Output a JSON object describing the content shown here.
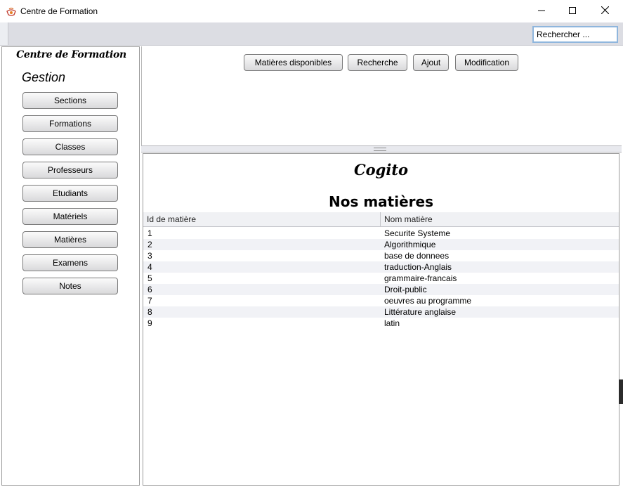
{
  "window": {
    "title": "Centre de Formation",
    "controls": [
      "minimize-icon",
      "maximize-icon",
      "close-icon"
    ]
  },
  "toolbar": {
    "search_value": "Rechercher ..."
  },
  "sidebar": {
    "brand": "Centre de Formation",
    "section_title": "Gestion",
    "items": [
      {
        "label": "Sections"
      },
      {
        "label": "Formations"
      },
      {
        "label": "Classes"
      },
      {
        "label": "Professeurs"
      },
      {
        "label": "Etudiants"
      },
      {
        "label": "Matériels"
      },
      {
        "label": "Matières"
      },
      {
        "label": "Examens"
      },
      {
        "label": "Notes"
      }
    ]
  },
  "actions": {
    "items": [
      {
        "label": "Matières disponibles"
      },
      {
        "label": "Recherche"
      },
      {
        "label": "Ajout"
      },
      {
        "label": "Modification"
      }
    ]
  },
  "main": {
    "brand": "Cogito",
    "title": "Nos matières",
    "columns": [
      "Id de matière",
      "Nom matière"
    ],
    "rows": [
      [
        "1",
        "Securite Systeme"
      ],
      [
        "2",
        "Algorithmique"
      ],
      [
        "3",
        "base de donnees"
      ],
      [
        "4",
        "traduction-Anglais"
      ],
      [
        "5",
        "grammaire-francais"
      ],
      [
        "6",
        "Droit-public"
      ],
      [
        "7",
        "oeuvres au programme"
      ],
      [
        "8",
        "Littérature anglaise"
      ],
      [
        "9",
        "latin"
      ]
    ]
  },
  "colors": {
    "toolbar_bg": "#dcdde3",
    "search_border": "#8fb6dd",
    "row_alt": "#f1f2f6"
  }
}
